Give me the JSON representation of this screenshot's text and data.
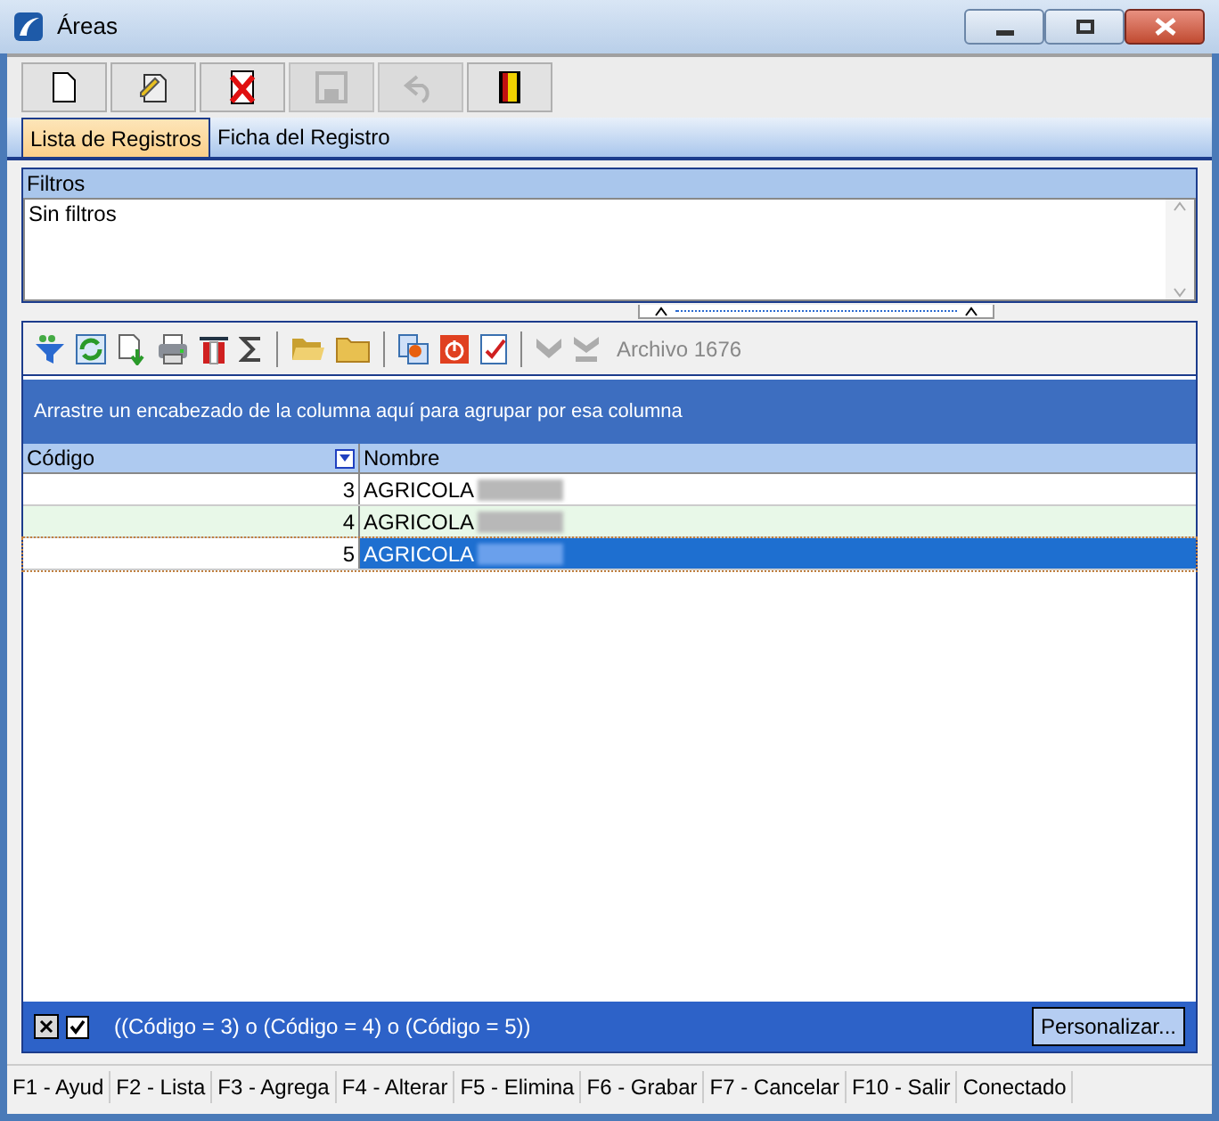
{
  "window": {
    "title": "Áreas"
  },
  "toolbar": [
    {
      "kind": "new",
      "disabled": false
    },
    {
      "kind": "edit",
      "disabled": false
    },
    {
      "kind": "delete",
      "disabled": false
    },
    {
      "kind": "save",
      "disabled": true
    },
    {
      "kind": "undo",
      "disabled": true
    },
    {
      "kind": "exit",
      "disabled": false
    }
  ],
  "tabs": [
    {
      "label": "Lista de Registros",
      "selected": true
    },
    {
      "label": "Ficha del Registro",
      "selected": false
    }
  ],
  "filters": {
    "title": "Filtros",
    "value": "Sin filtros"
  },
  "grid_toolbar": {
    "tools": [
      {
        "kind": "filter",
        "disabled": false
      },
      {
        "kind": "refresh",
        "disabled": false
      },
      {
        "kind": "export",
        "disabled": false
      },
      {
        "kind": "print",
        "disabled": false
      },
      {
        "kind": "columns",
        "disabled": false
      },
      {
        "kind": "sum",
        "disabled": false
      },
      {
        "kind": "sep"
      },
      {
        "kind": "open",
        "disabled": false
      },
      {
        "kind": "folder",
        "disabled": false
      },
      {
        "kind": "sep"
      },
      {
        "kind": "settings",
        "disabled": false
      },
      {
        "kind": "power",
        "disabled": false
      },
      {
        "kind": "check",
        "disabled": false
      },
      {
        "kind": "sep"
      },
      {
        "kind": "down",
        "disabled": true
      },
      {
        "kind": "last",
        "disabled": true
      }
    ],
    "label": "Archivo 1676"
  },
  "group_hint": "Arrastre un encabezado de la columna aquí para agrupar por esa columna",
  "table": {
    "columns": [
      "Código",
      "Nombre"
    ],
    "rows": [
      {
        "cells": [
          "3",
          "AGRICOLA"
        ],
        "selected": false,
        "alternate": false
      },
      {
        "cells": [
          "4",
          "AGRICOLA"
        ],
        "selected": false,
        "alternate": true
      },
      {
        "cells": [
          "5",
          "AGRICOLA"
        ],
        "selected": true,
        "alternate": false
      }
    ]
  },
  "filter_bar": {
    "enabled": true,
    "expression": "((Código = 3) o (Código = 4) o (Código = 5))",
    "button": "Personalizar..."
  },
  "status_bar": [
    "F1 - Ayud",
    "F2 - Lista",
    "F3 - Agrega",
    "F4 - Alterar",
    "F5 - Elimina",
    "F6 - Grabar",
    "F7 - Cancelar",
    "F10 - Salir",
    "Conectado"
  ]
}
